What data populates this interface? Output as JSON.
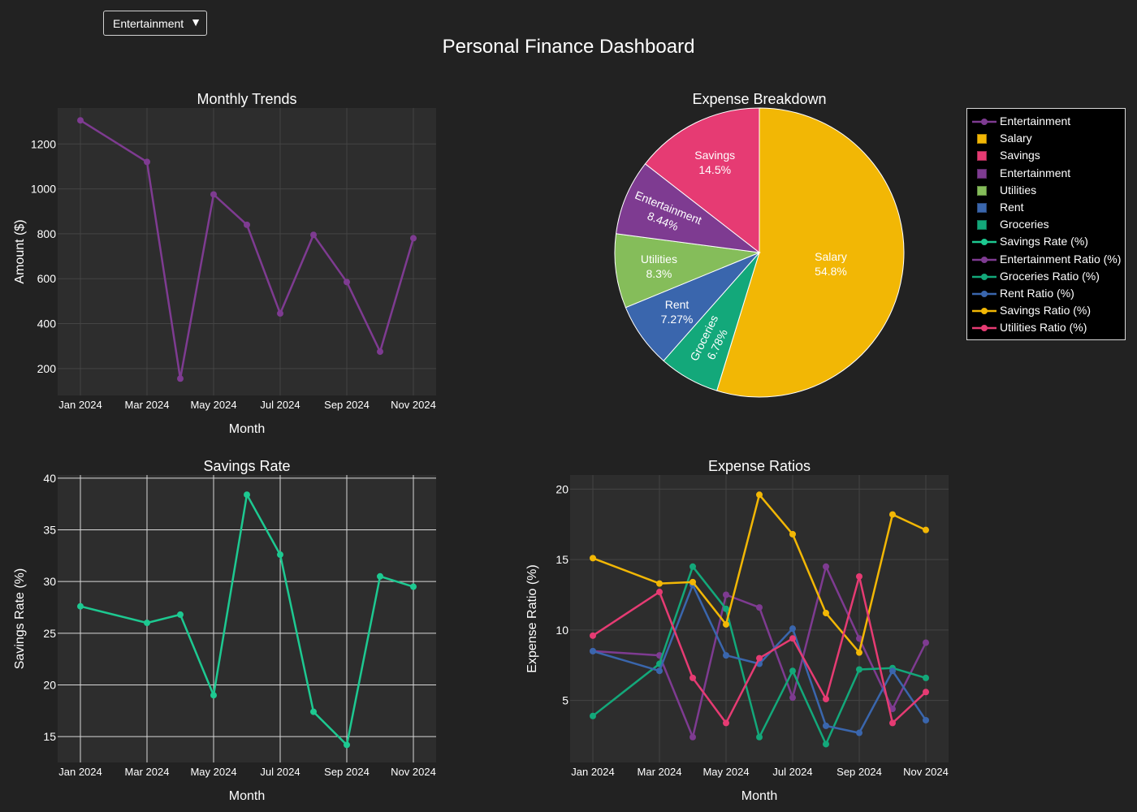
{
  "dashboard": {
    "title": "Personal Finance Dashboard",
    "dropdown": {
      "selected": "Entertainment",
      "arrow": "▼"
    }
  },
  "colors": {
    "background": "#222222",
    "plot_bg": "#2d2d2d",
    "entertainment": "#7e3b91",
    "salary": "#f2b705",
    "savings": "#e63b73",
    "utilities": "#85bd5a",
    "rent": "#3a66ad",
    "groceries": "#13a87a",
    "savings_rate": "#1dc991",
    "savings_ratio": "#f2b705",
    "groceries_ratio": "#13a87a"
  },
  "legend": {
    "items": [
      {
        "label": "Entertainment",
        "kind": "line",
        "color": "#7e3b91"
      },
      {
        "label": "Salary",
        "kind": "box",
        "color": "#f2b705"
      },
      {
        "label": "Savings",
        "kind": "box",
        "color": "#e63b73"
      },
      {
        "label": "Entertainment",
        "kind": "box",
        "color": "#7e3b91"
      },
      {
        "label": "Utilities",
        "kind": "box",
        "color": "#85bd5a"
      },
      {
        "label": "Rent",
        "kind": "box",
        "color": "#3a66ad"
      },
      {
        "label": "Groceries",
        "kind": "box",
        "color": "#13a87a"
      },
      {
        "label": "Savings Rate (%)",
        "kind": "line",
        "color": "#1dc991"
      },
      {
        "label": "Entertainment Ratio (%)",
        "kind": "line",
        "color": "#7e3b91"
      },
      {
        "label": "Groceries Ratio (%)",
        "kind": "line",
        "color": "#13a87a"
      },
      {
        "label": "Rent Ratio (%)",
        "kind": "line",
        "color": "#3a66ad"
      },
      {
        "label": "Savings Ratio (%)",
        "kind": "line",
        "color": "#f2b705"
      },
      {
        "label": "Utilities Ratio (%)",
        "kind": "line",
        "color": "#e63b73"
      }
    ]
  },
  "chart_data": [
    {
      "id": "monthly-trends",
      "type": "line",
      "title": "Monthly Trends",
      "xlabel": "Month",
      "ylabel": "Amount ($)",
      "x": [
        "2024-01",
        "2024-03",
        "2024-04",
        "2024-05",
        "2024-06",
        "2024-07",
        "2024-08",
        "2024-09",
        "2024-10",
        "2024-11"
      ],
      "xticks": [
        "Jan 2024",
        "Mar 2024",
        "May 2024",
        "Jul 2024",
        "Sep 2024",
        "Nov 2024"
      ],
      "yticks": [
        200,
        400,
        600,
        800,
        1000,
        1200
      ],
      "ylim": [
        80,
        1360
      ],
      "grid": true,
      "series": [
        {
          "name": "Entertainment",
          "color": "#7e3b91",
          "values": [
            1305,
            1120,
            155,
            975,
            840,
            445,
            795,
            585,
            275,
            780
          ]
        }
      ]
    },
    {
      "id": "expense-breakdown",
      "type": "pie",
      "title": "Expense Breakdown",
      "slices": [
        {
          "label": "Salary",
          "percent_text": "54.8%",
          "value": 54.8,
          "color": "#f2b705"
        },
        {
          "label": "Groceries",
          "percent_text": "6.78%",
          "value": 6.78,
          "color": "#13a87a"
        },
        {
          "label": "Rent",
          "percent_text": "7.27%",
          "value": 7.27,
          "color": "#3a66ad"
        },
        {
          "label": "Utilities",
          "percent_text": "8.3%",
          "value": 8.3,
          "color": "#85bd5a"
        },
        {
          "label": "Entertainment",
          "percent_text": "8.44%",
          "value": 8.44,
          "color": "#7e3b91"
        },
        {
          "label": "Savings",
          "percent_text": "14.5%",
          "value": 14.5,
          "color": "#e63b73"
        }
      ]
    },
    {
      "id": "savings-rate",
      "type": "line",
      "title": "Savings Rate",
      "xlabel": "Month",
      "ylabel": "Savings Rate (%)",
      "x": [
        "2024-01",
        "2024-03",
        "2024-04",
        "2024-05",
        "2024-06",
        "2024-07",
        "2024-08",
        "2024-09",
        "2024-10",
        "2024-11"
      ],
      "xticks": [
        "Jan 2024",
        "Mar 2024",
        "May 2024",
        "Jul 2024",
        "Sep 2024",
        "Nov 2024"
      ],
      "yticks": [
        15,
        20,
        25,
        30,
        35,
        40
      ],
      "ylim": [
        12.5,
        40.3
      ],
      "grid": true,
      "series": [
        {
          "name": "Savings Rate (%)",
          "color": "#1dc991",
          "values": [
            27.6,
            26.0,
            26.8,
            19.0,
            38.4,
            32.6,
            17.4,
            14.2,
            30.5,
            29.5
          ]
        }
      ]
    },
    {
      "id": "expense-ratios",
      "type": "line",
      "title": "Expense Ratios",
      "xlabel": "Month",
      "ylabel": "Expense Ratio (%)",
      "x": [
        "2024-01",
        "2024-03",
        "2024-04",
        "2024-05",
        "2024-06",
        "2024-07",
        "2024-08",
        "2024-09",
        "2024-10",
        "2024-11"
      ],
      "xticks": [
        "Jan 2024",
        "Mar 2024",
        "May 2024",
        "Jul 2024",
        "Sep 2024",
        "Nov 2024"
      ],
      "yticks": [
        5,
        10,
        15,
        20
      ],
      "ylim": [
        0.6,
        21
      ],
      "grid": true,
      "series": [
        {
          "name": "Entertainment Ratio (%)",
          "color": "#7e3b91",
          "values": [
            8.5,
            8.2,
            2.4,
            12.5,
            11.6,
            5.2,
            14.5,
            9.4,
            4.4,
            9.1
          ]
        },
        {
          "name": "Groceries Ratio (%)",
          "color": "#13a87a",
          "values": [
            3.9,
            7.6,
            14.5,
            11.5,
            2.4,
            7.1,
            1.9,
            7.2,
            7.3,
            6.6
          ]
        },
        {
          "name": "Rent Ratio (%)",
          "color": "#3a66ad",
          "values": [
            8.5,
            7.1,
            13.2,
            8.2,
            7.6,
            10.1,
            3.2,
            2.7,
            7.1,
            3.6
          ]
        },
        {
          "name": "Savings Ratio (%)",
          "color": "#f2b705",
          "values": [
            15.1,
            13.3,
            13.4,
            10.4,
            19.6,
            16.8,
            11.2,
            8.4,
            18.2,
            17.1
          ]
        },
        {
          "name": "Utilities Ratio (%)",
          "color": "#e63b73",
          "values": [
            9.6,
            12.7,
            6.6,
            3.4,
            8.0,
            9.4,
            5.1,
            13.8,
            3.4,
            5.6
          ]
        }
      ]
    }
  ]
}
